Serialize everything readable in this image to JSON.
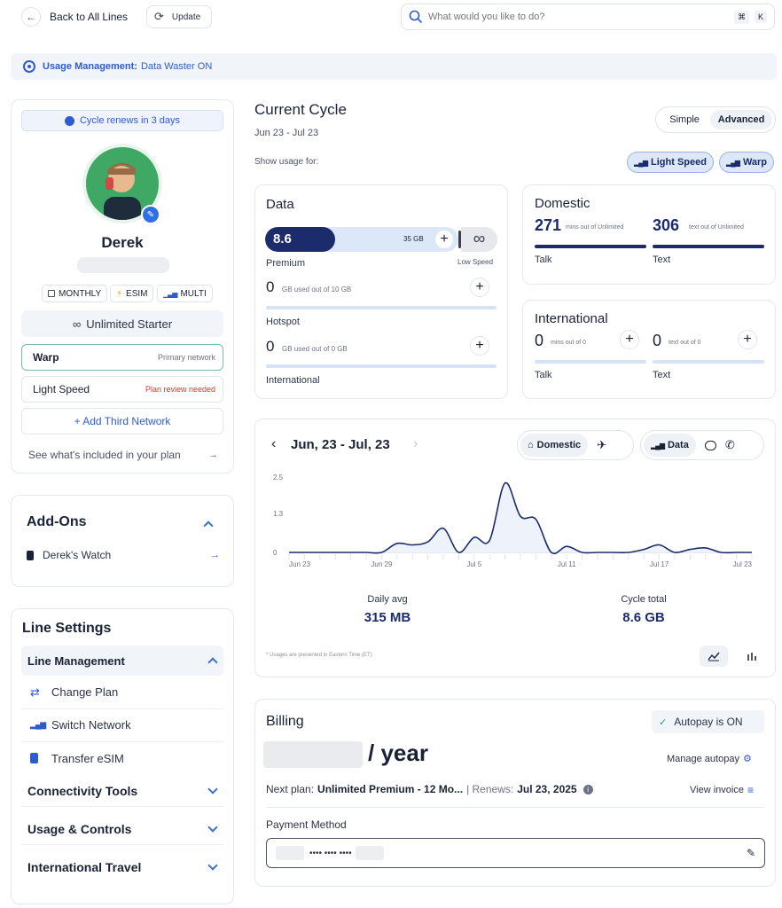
{
  "topbar": {
    "back_label": "Back to All Lines",
    "update_label": "Update",
    "search_placeholder": "What would you like to do?",
    "kbd_cmd": "⌘",
    "kbd_k": "K"
  },
  "usage_banner": {
    "label": "Usage Management:",
    "value": "Data Waster ON"
  },
  "profile": {
    "renew_text": "Cycle renews in 3 days",
    "name": "Derek",
    "chips": [
      "MONTHLY",
      "ESIM",
      "MULTI"
    ],
    "plan_name": "Unlimited Starter",
    "networks": [
      {
        "name": "Warp",
        "status": "Primary network"
      },
      {
        "name": "Light Speed",
        "status": "Plan review needed"
      }
    ],
    "add_network": "+ Add Third Network",
    "see_included": "See what's included in your plan"
  },
  "addons": {
    "title": "Add-Ons",
    "items": [
      {
        "label": "Derek's Watch"
      }
    ]
  },
  "line_settings": {
    "title": "Line Settings",
    "line_management": "Line Management",
    "items": [
      "Change Plan",
      "Switch Network",
      "Transfer eSIM"
    ],
    "sections": [
      "Connectivity Tools",
      "Usage & Controls",
      "International Travel"
    ]
  },
  "cycle": {
    "title": "Current Cycle",
    "dates": "Jun 23 - Jul 23",
    "mode_simple": "Simple",
    "mode_advanced": "Advanced",
    "show_usage_for": "Show usage for:",
    "network_filters": [
      "Light Speed",
      "Warp"
    ]
  },
  "data_card": {
    "title": "Data",
    "used_value": "8.6",
    "cap_label": "35 GB",
    "low_speed": "Low Speed",
    "used_fraction": 0.245,
    "premium_label": "Premium",
    "premium_value": "0",
    "premium_note": "GB used out of 10 GB",
    "hotspot_label": "Hotspot",
    "hotspot_value": "0",
    "hotspot_note": "GB used out of 0 GB",
    "international_label": "International"
  },
  "domestic_card": {
    "title": "Domestic",
    "talk_value": "271",
    "talk_note": "mins out of Unlimited",
    "text_value": "306",
    "text_note": "text out of Unlimited",
    "talk_label": "Talk",
    "text_label": "Text"
  },
  "international_card": {
    "title": "International",
    "talk_value": "0",
    "talk_note": "mins out of 0",
    "text_value": "0",
    "text_note": "text out of 0",
    "talk_label": "Talk",
    "text_label": "Text"
  },
  "usage_chart": {
    "range": "Jun, 23 - Jul, 23",
    "scope_label": "Domestic",
    "type_label": "Data",
    "daily_avg_label": "Daily avg",
    "daily_avg_value": "315 MB",
    "cycle_total_label": "Cycle total",
    "cycle_total_value": "8.6 GB",
    "footnote": "* Usages are presented in Eastern Time (ET)"
  },
  "chart_data": {
    "type": "area",
    "y_ticks": [
      "2.5",
      "1.3",
      "0"
    ],
    "x_ticks": [
      "Jun 23",
      "Jun 29",
      "Jul 5",
      "Jul 11",
      "Jul 17",
      "Jul 23"
    ],
    "ylim": [
      0,
      2.5
    ],
    "x": [
      "Jun 23",
      "Jun 24",
      "Jun 25",
      "Jun 26",
      "Jun 27",
      "Jun 28",
      "Jun 29",
      "Jun 30",
      "Jul 1",
      "Jul 2",
      "Jul 3",
      "Jul 4",
      "Jul 5",
      "Jul 6",
      "Jul 7",
      "Jul 8",
      "Jul 9",
      "Jul 10",
      "Jul 11",
      "Jul 12",
      "Jul 13",
      "Jul 14",
      "Jul 15",
      "Jul 16",
      "Jul 17",
      "Jul 18",
      "Jul 19",
      "Jul 20",
      "Jul 21",
      "Jul 22",
      "Jul 23"
    ],
    "values": [
      0,
      0,
      0,
      0,
      0,
      0,
      0,
      0.3,
      0.25,
      0.35,
      0.8,
      0,
      0.5,
      0.4,
      2.3,
      1.2,
      1.1,
      0,
      0.2,
      0,
      0,
      0,
      0,
      0.1,
      0.25,
      0,
      0.1,
      0.15,
      0,
      0,
      0
    ]
  },
  "billing": {
    "title": "Billing",
    "autopay": "Autopay is ON",
    "price_suffix": "/ year",
    "manage_autopay": "Manage autopay",
    "next_plan_label": "Next plan:",
    "next_plan_value": "Unlimited Premium - 12 Mo...",
    "renews_label": "| Renews:",
    "renews_value": "Jul 23, 2025",
    "view_invoice": "View invoice",
    "payment_method_label": "Payment Method",
    "card_mask": "•••• •••• ••••"
  },
  "colors": {
    "navy": "#1b2b6b",
    "accent": "#2f5bd0",
    "light_blue": "#dce7f8",
    "warning": "#d13a2f"
  }
}
